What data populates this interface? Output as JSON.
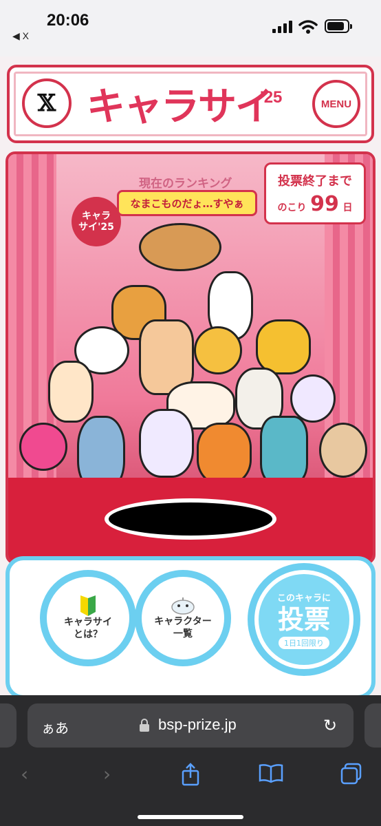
{
  "status": {
    "time": "20:06",
    "back_label": "◀ X"
  },
  "header": {
    "x_label": "𝕏",
    "logo": "キャラサイ",
    "logo_year": "'25",
    "menu_label": "MENU"
  },
  "stage": {
    "ranking_label": "現在のランキング",
    "bubble_text": "なまこものだょ…すやぁ",
    "mini_logo": "キャラ\nサイ'25",
    "countdown": {
      "title": "投票終了まで",
      "prefix": "のこり",
      "days": "99",
      "unit": "日"
    }
  },
  "nav": {
    "about_label": "キャラサイ\nとは？",
    "list_label": "キャラクター\n一覧",
    "vote_pre": "このキャラに",
    "vote_main": "投票",
    "vote_sub": "1日1回限り"
  },
  "browser": {
    "aa_label": "ぁあ",
    "url": "bsp-prize.jp"
  },
  "colors": {
    "brand_red": "#d3324c",
    "brand_blue": "#6ccff0",
    "accent_yellow": "#ffe45a"
  }
}
